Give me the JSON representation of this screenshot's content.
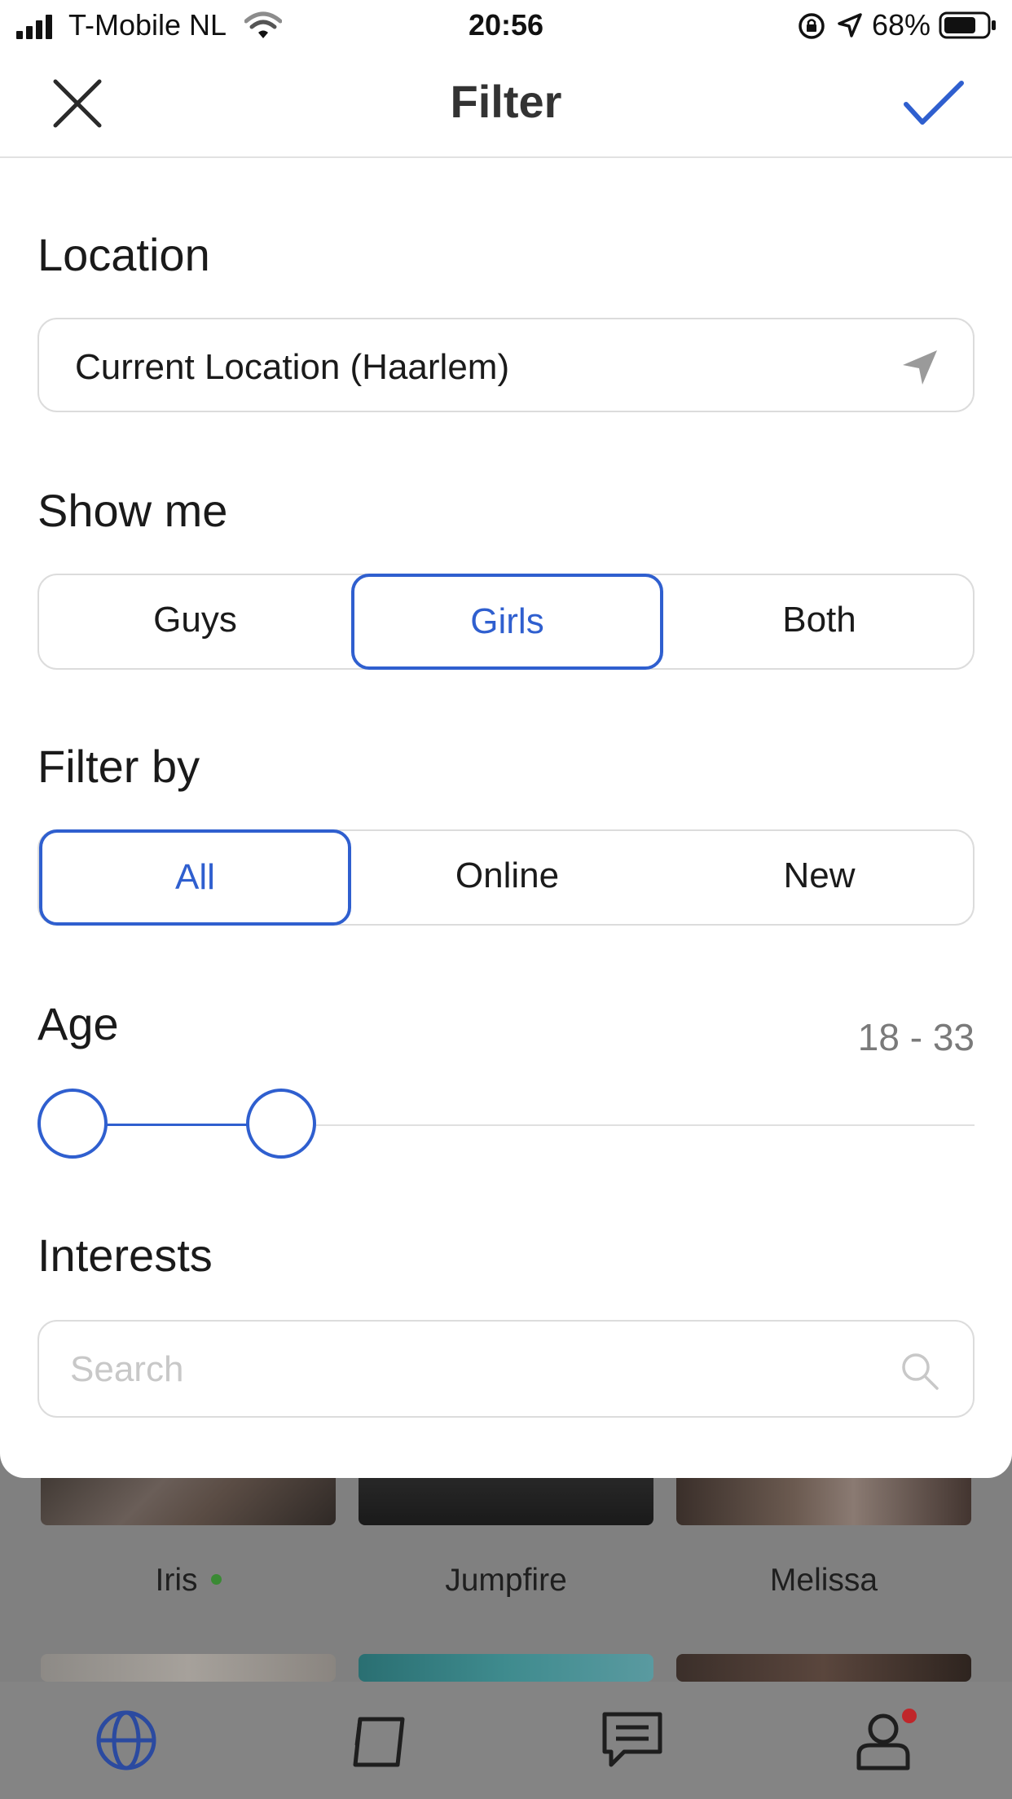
{
  "status_bar": {
    "carrier": "T-Mobile NL",
    "time": "20:56",
    "battery_percent": "68%"
  },
  "nav": {
    "title": "Filter",
    "close_icon": "close-icon",
    "confirm_icon": "checkmark-icon"
  },
  "location": {
    "title": "Location",
    "value": "Current Location (Haarlem)",
    "icon": "location-arrow-icon"
  },
  "show_me": {
    "title": "Show me",
    "options": [
      "Guys",
      "Girls",
      "Both"
    ],
    "selected": "Girls"
  },
  "filter_by": {
    "title": "Filter by",
    "options": [
      "All",
      "Online",
      "New"
    ],
    "selected": "All"
  },
  "age": {
    "title": "Age",
    "range_text": "18 - 33",
    "min": 18,
    "max": 33
  },
  "interests": {
    "title": "Interests",
    "search_placeholder": "Search"
  },
  "background": {
    "profiles": [
      {
        "name": "Iris",
        "online": true
      },
      {
        "name": "Jumpfire",
        "online": false
      },
      {
        "name": "Melissa",
        "online": false
      }
    ],
    "tabs": [
      "globe-icon",
      "cards-icon",
      "chat-icon",
      "profile-icon"
    ]
  },
  "colors": {
    "accent": "#2f5fcf",
    "online": "#3a8a34",
    "notification": "#c0262a"
  }
}
